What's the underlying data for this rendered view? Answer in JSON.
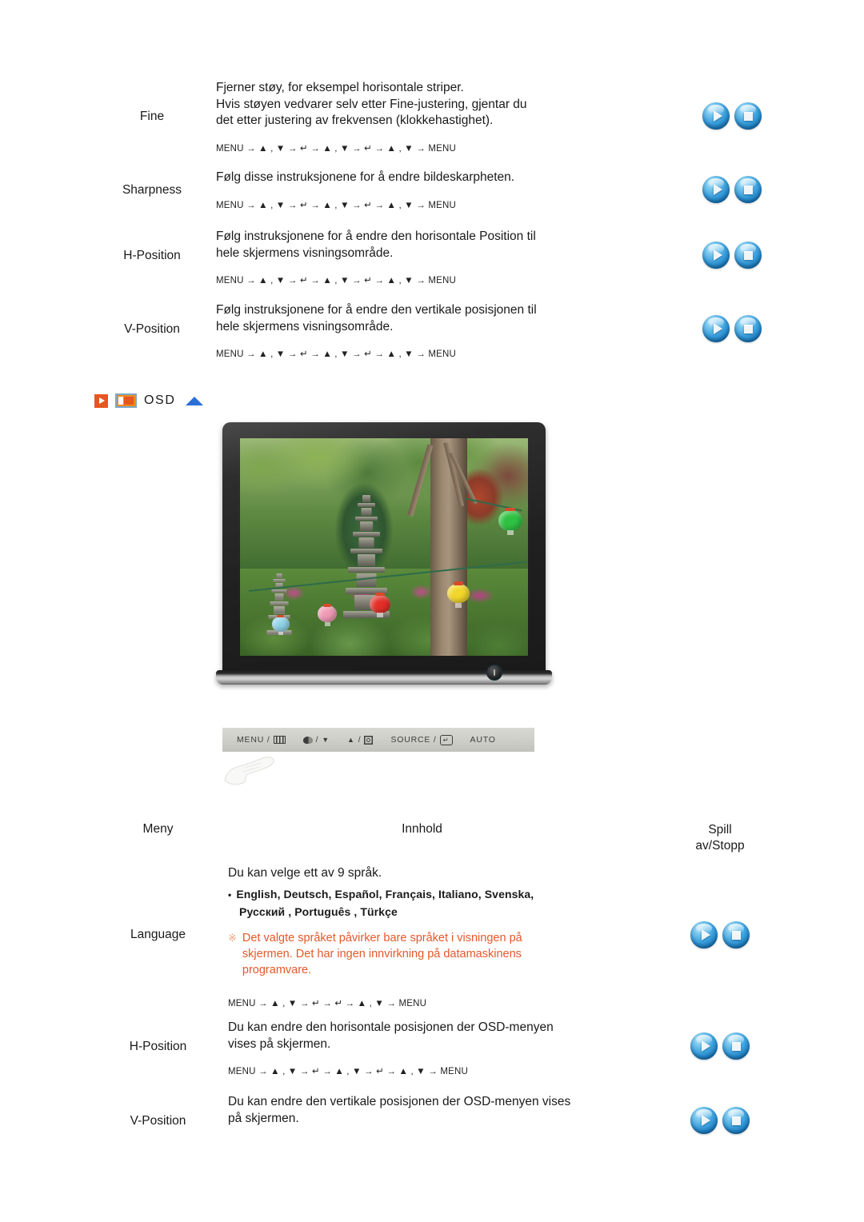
{
  "colors": {
    "accent_orange": "#e8561f",
    "note_orange": "#e4582a",
    "blue_triangle": "#2a6fd6",
    "sphere_blue": "#3aa0dd"
  },
  "nav_tokens": {
    "menu": "MENU",
    "arrow": "→",
    "up": "▲",
    "down": "▼",
    "comma": ",",
    "enter": "↵"
  },
  "top_table": {
    "rows": [
      {
        "menu": "Fine",
        "lines": [
          "Fjerner støy, for eksempel horisontale striper.",
          "Hvis støyen vedvarer selv etter Fine-justering, gjentar du",
          "det etter justering av frekvensen (klokkehastighet)."
        ],
        "nav": "MENU → ▲ , ▼ → ↵ → ▲ , ▼ → ↵ → ▲ , ▼ → MENU",
        "play_label": "Spill",
        "stop_label": "Stopp"
      },
      {
        "menu": "Sharpness",
        "lines": [
          "Følg disse instruksjonene for å endre bildeskarpheten."
        ],
        "nav": "MENU → ▲ , ▼ → ↵ → ▲ , ▼ → ↵ → ▲ , ▼ → MENU",
        "play_label": "Spill",
        "stop_label": "Stopp"
      },
      {
        "menu": "H-Position",
        "lines": [
          "Følg instruksjonene for å endre den horisontale Position til",
          "hele skjermens visningsområde."
        ],
        "nav": "MENU → ▲ , ▼ → ↵ → ▲ , ▼ → ↵ → ▲ , ▼ → MENU",
        "play_label": "Spill",
        "stop_label": "Stopp"
      },
      {
        "menu": "V-Position",
        "lines": [
          "Følg instruksjonene for å endre den vertikale posisjonen til",
          "hele skjermens visningsområde."
        ],
        "nav": "MENU → ▲ , ▼ → ↵ → ▲ , ▼ → ↵ → ▲ , ▼ → MENU",
        "play_label": "Spill",
        "stop_label": "Stopp"
      }
    ]
  },
  "section": {
    "title": "OSD",
    "play_icon": "play-square-icon",
    "monitor_icon": "monitor-icon",
    "up_icon": "up-triangle-icon"
  },
  "monitor": {
    "alt": "Samsung flat panel monitor showing a garden photograph with a stone pagoda and paper lanterns",
    "power_icon": "power-button-icon"
  },
  "control_bar": {
    "items": [
      {
        "label": "MENU /",
        "icon": "menu-grid-icon"
      },
      {
        "label": "/",
        "icon": "contrast-icon",
        "icon2": "down-arrow-icon"
      },
      {
        "label": "/",
        "icon": "up-arrow-icon",
        "icon2": "brightness-icon"
      },
      {
        "label": "SOURCE /",
        "icon": "enter-icon"
      },
      {
        "label": "AUTO",
        "icon": ""
      }
    ],
    "menu_label": "MENU /",
    "source_label": "SOURCE /",
    "auto_label": "AUTO",
    "slash": "/"
  },
  "bottom_table": {
    "header": {
      "menu": "Meny",
      "content": "Innhold",
      "play_line1": "Spill",
      "play_line2": "av/Stopp"
    },
    "rows": [
      {
        "menu": "Language",
        "intro": "Du kan velge ett av 9 språk.",
        "languages_line1": "English, Deutsch, Español, Français,  Italiano, Svenska,",
        "languages_line2": "Русский , Português , Türkçe",
        "note_mark": "※",
        "note_lines": [
          "Det valgte språket påvirker bare språket i visningen på",
          "skjermen. Det har ingen innvirkning på datamaskinens",
          "programvare."
        ],
        "nav": "MENU → ▲ , ▼ → ↵ → ↵ → ▲ , ▼ → MENU",
        "play_label": "Spill",
        "stop_label": "Stopp"
      },
      {
        "menu": "H-Position",
        "lines": [
          "Du kan endre den horisontale posisjonen der OSD-menyen",
          "vises på skjermen."
        ],
        "nav": "MENU → ▲ , ▼ → ↵ → ▲ , ▼ → ↵ → ▲ , ▼ → MENU",
        "play_label": "Spill",
        "stop_label": "Stopp"
      },
      {
        "menu": "V-Position",
        "lines": [
          "Du kan endre den vertikale posisjonen der OSD-menyen vises",
          "på skjermen."
        ],
        "nav": "",
        "play_label": "Spill",
        "stop_label": "Stopp"
      }
    ]
  }
}
